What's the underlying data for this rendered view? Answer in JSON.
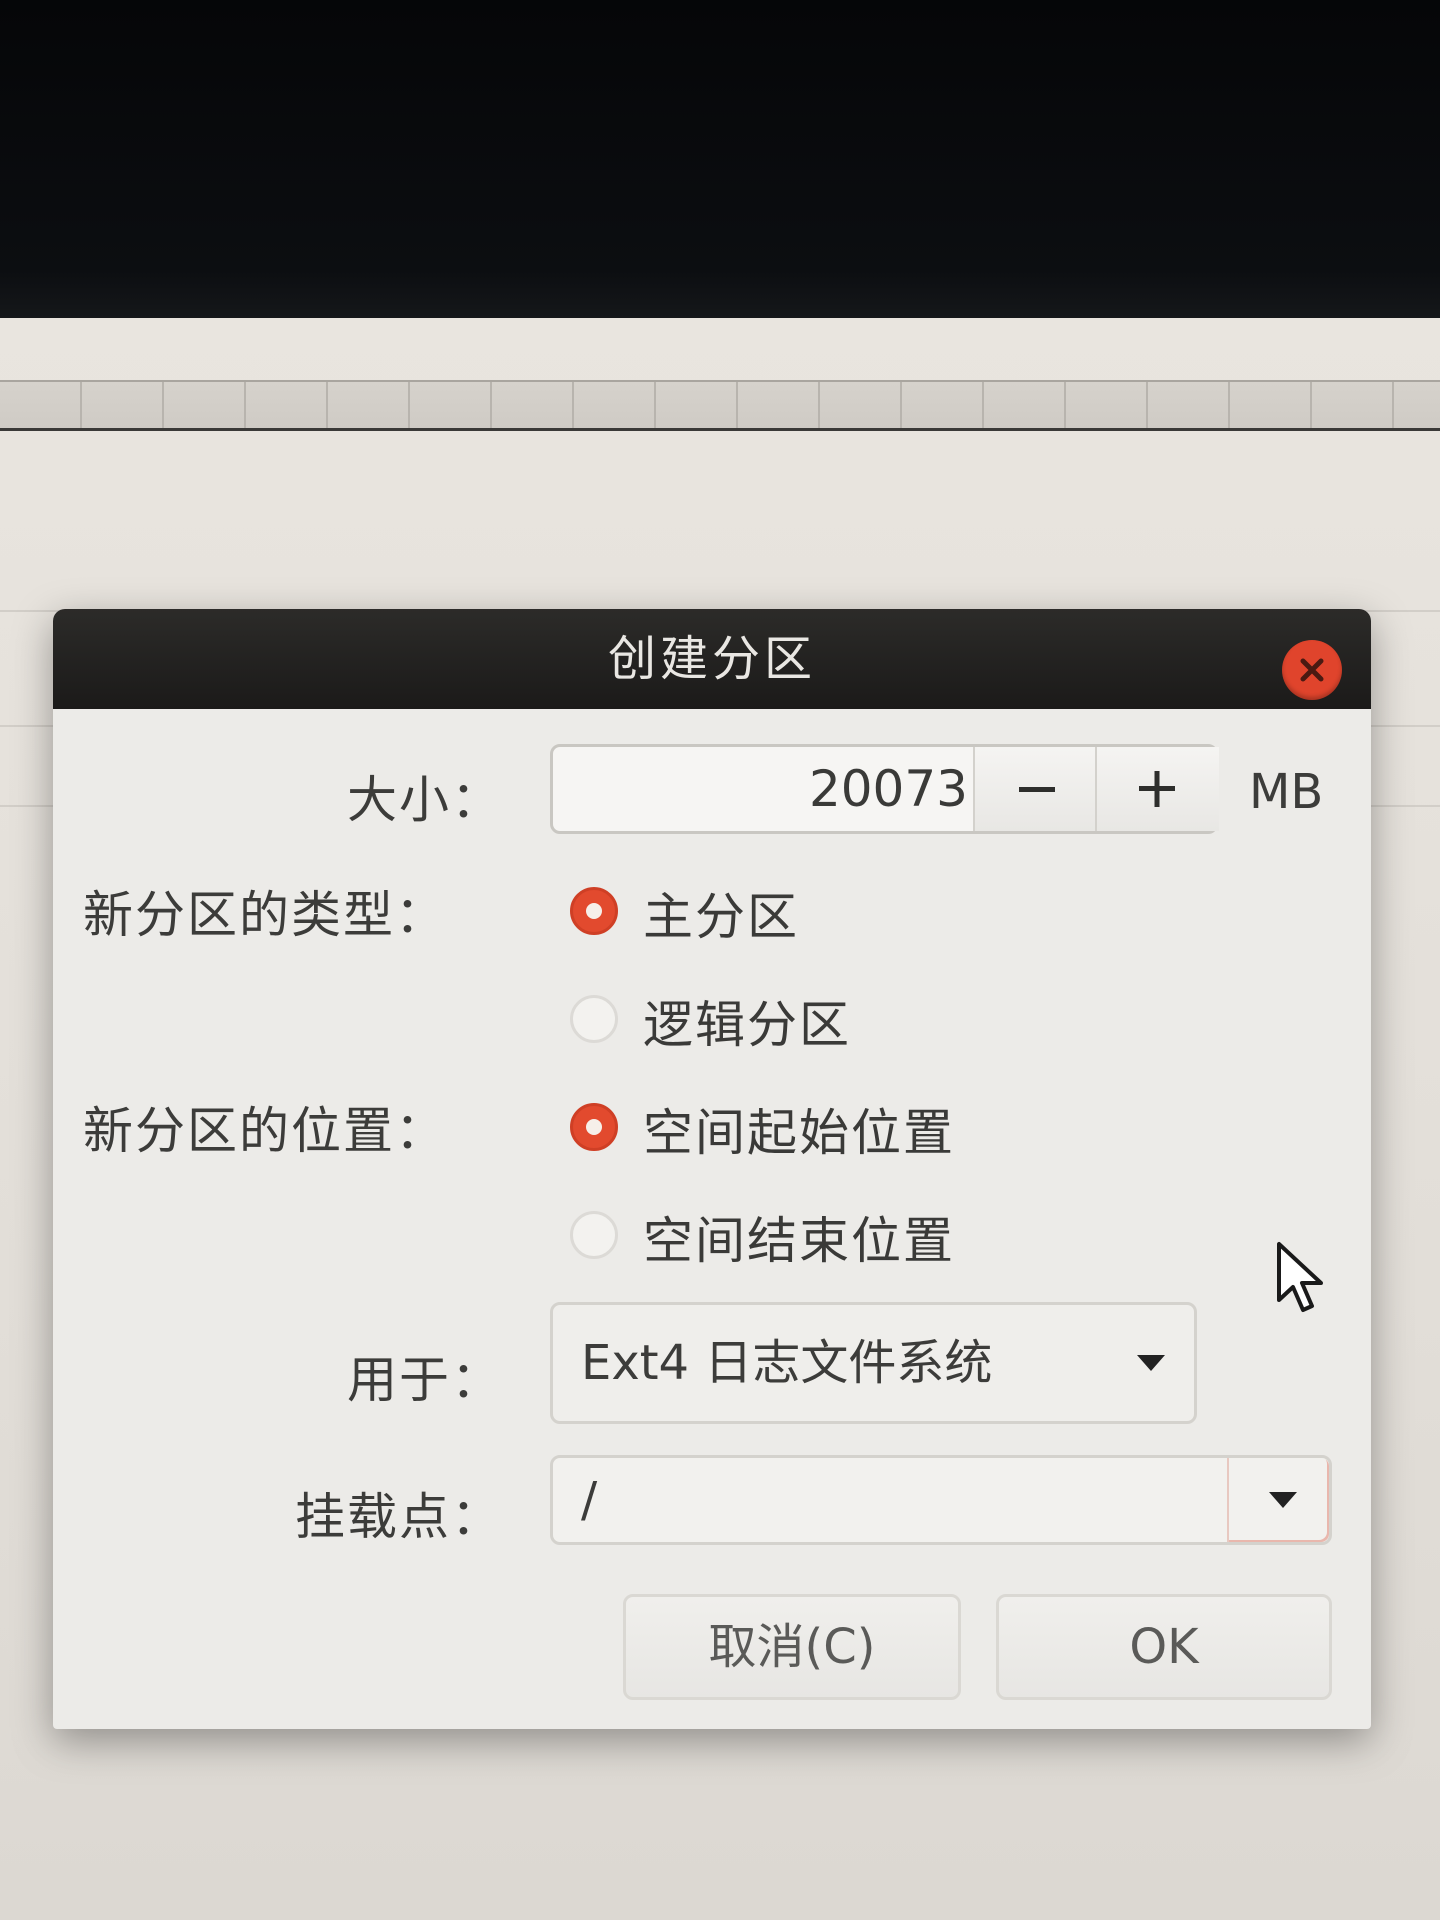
{
  "dialog": {
    "title": "创建分区",
    "size": {
      "label": "大小：",
      "value": "20073",
      "decrement": "−",
      "increment": "+",
      "unit": "MB"
    },
    "type": {
      "label": "新分区的类型：",
      "options": [
        {
          "label": "主分区",
          "selected": true
        },
        {
          "label": "逻辑分区",
          "selected": false
        }
      ]
    },
    "location": {
      "label": "新分区的位置：",
      "options": [
        {
          "label": "空间起始位置",
          "selected": true
        },
        {
          "label": "空间结束位置",
          "selected": false
        }
      ]
    },
    "use_as": {
      "label": "用于：",
      "value": "Ext4 日志文件系统"
    },
    "mount_point": {
      "label": "挂载点：",
      "value": "/"
    },
    "buttons": {
      "cancel": "取消(C)",
      "ok": "OK"
    }
  },
  "colors": {
    "accent": "#e24a2e",
    "titlebar": "#1b1a19",
    "dialog_bg": "#ecebe8"
  },
  "icons": [
    "close-icon",
    "minus-icon",
    "plus-icon",
    "caret-down-icon",
    "mouse-pointer-icon"
  ]
}
